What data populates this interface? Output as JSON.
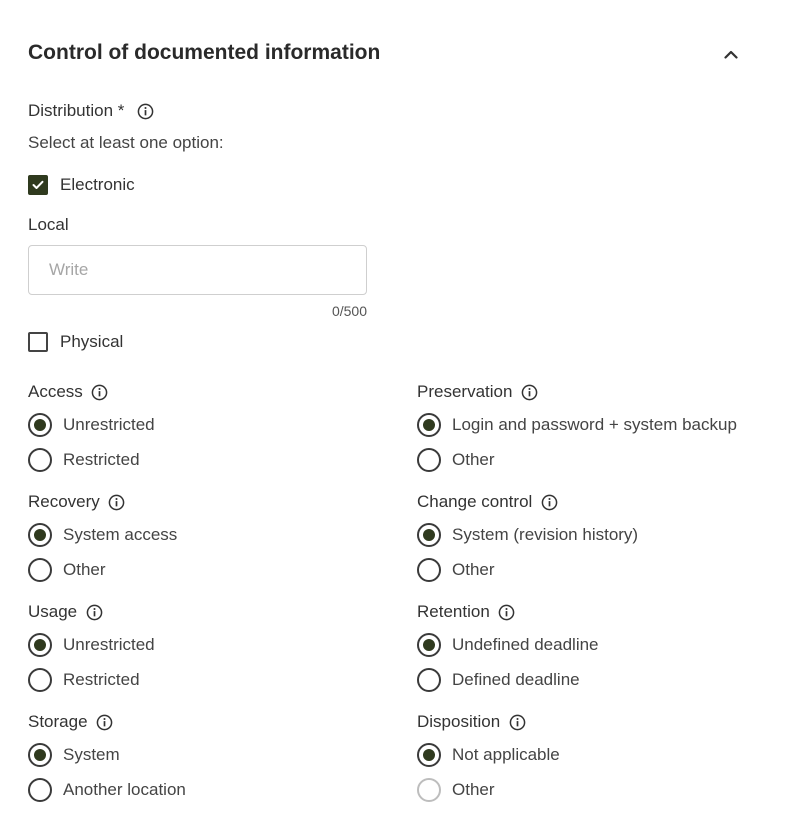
{
  "section": {
    "title": "Control of documented information"
  },
  "distribution": {
    "label": "Distribution *",
    "hint": "Select at least one option:",
    "electronic": {
      "label": "Electronic",
      "checked": true
    },
    "local": {
      "label": "Local",
      "placeholder": "Write",
      "value": "",
      "counter": "0/500"
    },
    "physical": {
      "label": "Physical",
      "checked": false
    }
  },
  "groups": {
    "access": {
      "title": "Access",
      "options": [
        "Unrestricted",
        "Restricted"
      ],
      "selected": 0
    },
    "preservation": {
      "title": "Preservation",
      "options": [
        "Login and password + system backup",
        "Other"
      ],
      "selected": 0
    },
    "recovery": {
      "title": "Recovery",
      "options": [
        "System access",
        "Other"
      ],
      "selected": 0
    },
    "change_control": {
      "title": "Change control",
      "options": [
        "System (revision history)",
        "Other"
      ],
      "selected": 0
    },
    "usage": {
      "title": "Usage",
      "options": [
        "Unrestricted",
        "Restricted"
      ],
      "selected": 0
    },
    "retention": {
      "title": "Retention",
      "options": [
        "Undefined deadline",
        "Defined deadline"
      ],
      "selected": 0
    },
    "storage": {
      "title": "Storage",
      "options": [
        "System",
        "Another location"
      ],
      "selected": 0
    },
    "disposition": {
      "title": "Disposition",
      "options": [
        "Not applicable",
        "Other"
      ],
      "selected": 0
    }
  },
  "colors": {
    "accent": "#2f3a1e",
    "text": "#333333",
    "border": "#cfcfcf"
  },
  "icons": {
    "collapse": "chevron-up-icon",
    "info": "info-icon",
    "check": "checkmark-icon"
  }
}
